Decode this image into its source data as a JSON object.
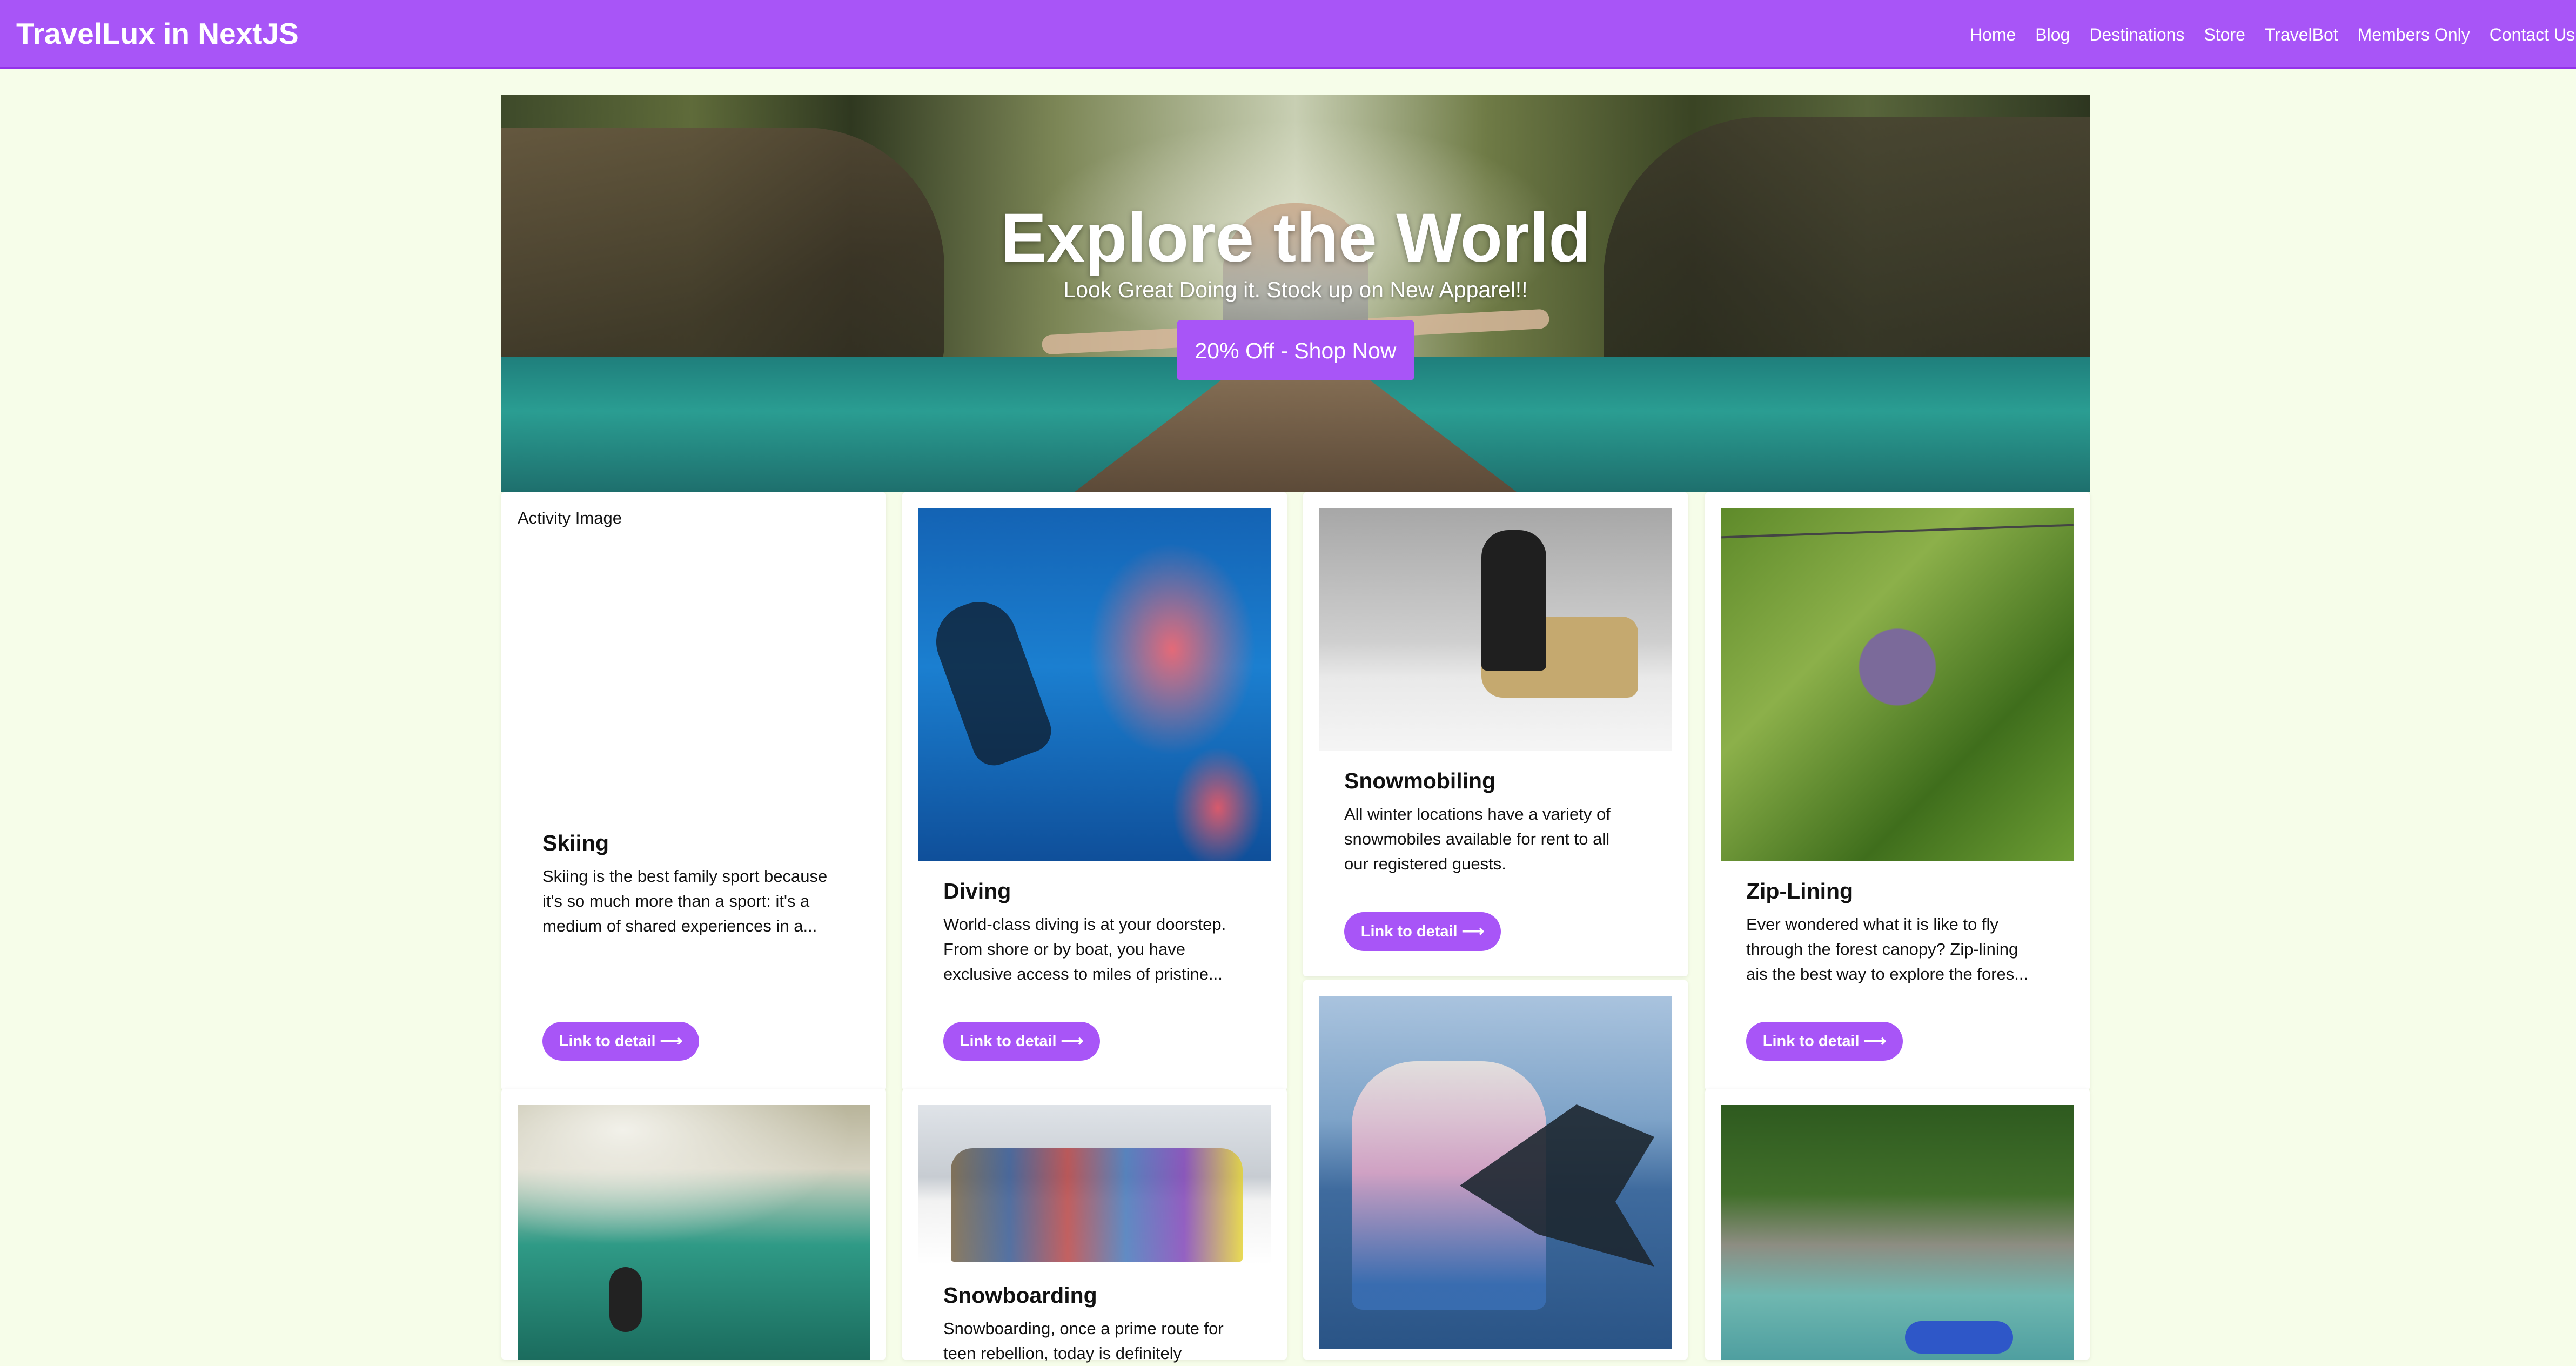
{
  "navbar": {
    "brand": "TravelLux in NextJS",
    "links": [
      "Home",
      "Blog",
      "Destinations",
      "Store",
      "TravelBot",
      "Members Only",
      "Contact Us"
    ]
  },
  "hero": {
    "title": "Explore the World",
    "subtitle": "Look Great Doing it. Stock up on New Apparel!!",
    "button_label": "20% Off - Shop Now"
  },
  "colors": {
    "accent": "#a855f7",
    "page_background": "#f6fde9"
  },
  "activities": [
    {
      "title": "Skiing",
      "image_alt": "Activity Image",
      "description_lines": [
        "Skiing is the best family sport because",
        "it's so much more than a sport: it's a",
        "medium of shared experiences in a..."
      ],
      "button_label": "Link to detail ⟶"
    },
    {
      "title": "Diving",
      "description_lines": [
        "World-class diving is at your doorstep.",
        "From shore or by boat, you have",
        "exclusive access to miles of pristine..."
      ],
      "button_label": "Link to detail ⟶"
    },
    {
      "title": "Snowmobiling",
      "description_lines": [
        "All winter locations have a variety of",
        "snowmobiles available for rent to all",
        "our registered guests."
      ],
      "button_label": "Link to detail ⟶"
    },
    {
      "title": "Zip-Lining",
      "description_lines": [
        "Ever wondered what it is like to fly",
        "through the forest canopy? Zip-lining",
        "ais the best way to explore the fores..."
      ],
      "button_label": "Link to detail ⟶"
    },
    {
      "title": "Snowboarding",
      "description_lines": [
        "Snowboarding, once a prime route for",
        "teen rebellion, today is definitely"
      ]
    }
  ]
}
